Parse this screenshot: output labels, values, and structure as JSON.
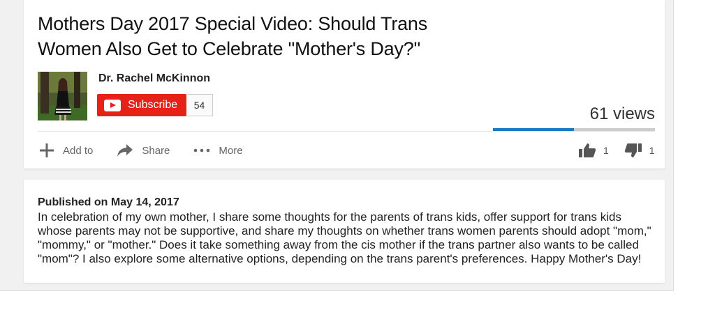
{
  "video": {
    "title_line1": "Mothers Day 2017 Special Video: Should Trans",
    "title_line2": "Women Also Get to Celebrate \"Mother's Day?\"",
    "views": "61 views",
    "like_ratio": 0.5
  },
  "channel": {
    "name": "Dr. Rachel McKinnon",
    "subscribe_label": "Subscribe",
    "subscriber_count": "54"
  },
  "actions": {
    "add_to": "Add to",
    "share": "Share",
    "more": "More",
    "likes": "1",
    "dislikes": "1"
  },
  "description": {
    "published": "Published on May 14, 2017",
    "text": "In celebration of my own mother, I share some thoughts for the parents of trans kids, offer support for trans kids whose parents may not be supportive, and share my thoughts on whether trans women parents should adopt \"mom,\" \"mommy,\" or \"mother.\" Does it take something away from the cis mother if the trans partner also wants to be called \"mom\"? I also explore some alternative options, depending on the trans parent's preferences. Happy Mother's Day!"
  },
  "colors": {
    "subscribe_red": "#e62117",
    "like_blue": "#167ac6"
  }
}
